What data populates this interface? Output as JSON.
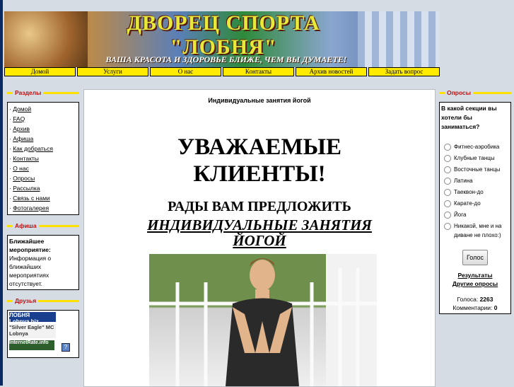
{
  "header": {
    "title": "ДВОРЕЦ СПОРТА \"ЛОБНЯ\"",
    "slogan": "ВАША КРАСОТА И ЗДОРОВЬЕ  БЛИЖЕ, ЧЕМ ВЫ ДУМАЕТЕ!"
  },
  "nav": [
    "Домой",
    "Услуги",
    "О нас",
    "Контакты",
    "Архив новостей",
    "Задать вопрос"
  ],
  "sections": {
    "title": "Разделы",
    "items": [
      "Домой",
      "FAQ",
      "Архив",
      "Афиша",
      "Как добраться",
      "Контакты",
      "О нас",
      "Опросы",
      "Рассылка",
      "Связь с нами",
      "Фотогалерея"
    ]
  },
  "afisha": {
    "title": "Афиша",
    "heading": "Ближайшее мероприятие:",
    "text": "Информация о ближайших мероприятиях отсутствует."
  },
  "friends": {
    "title": "Друзья",
    "badges": [
      "ЛОБНЯ Lobnya.biz",
      "\"Silver Eagle\" MC Lobnya",
      "InternetRate.info"
    ]
  },
  "main": {
    "title": "Индивидуальные занятия йогой",
    "line1": "УВАЖАЕМЫЕ",
    "line2": "КЛИЕНТЫ!",
    "line3": "РАДЫ ВАМ ПРЕДЛОЖИТЬ",
    "line4": "ИНДИВИДУАЛЬНЫЕ ЗАНЯТИЯ",
    "line5": "ЙОГОЙ"
  },
  "polls": {
    "title": "Опросы",
    "question": "В какой секции вы хотели бы заниматься?",
    "options": [
      "Фитнес-аэробика",
      "Клубные танцы",
      "Восточные танцы",
      "Латина",
      "Таеквон-до",
      "Карате-до",
      "Йога",
      "Никакой, мне и на диване не плохо:)"
    ],
    "button": "Голос",
    "results_link": "Результаты",
    "other_link": "Другие опросы",
    "votes_label": "Голоса:",
    "votes": "2263",
    "comments_label": "Комментарии:",
    "comments": "0"
  }
}
